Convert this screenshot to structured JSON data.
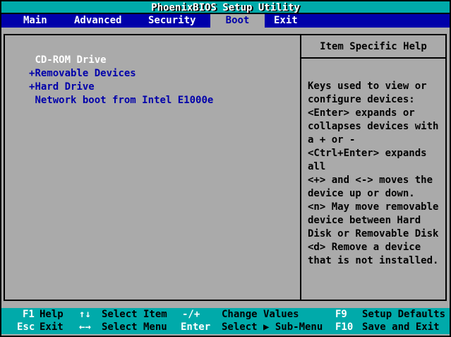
{
  "title": "PhoenixBIOS Setup Utility",
  "menu": {
    "tabs": [
      {
        "label": "Main",
        "active": false
      },
      {
        "label": "Advanced",
        "active": false
      },
      {
        "label": "Security",
        "active": false
      },
      {
        "label": "Boot",
        "active": true
      },
      {
        "label": "Exit",
        "active": false
      }
    ]
  },
  "boot_list": {
    "items": [
      {
        "prefix": " ",
        "label": "CD-ROM Drive",
        "selected": true
      },
      {
        "prefix": "+",
        "label": "Removable Devices",
        "selected": false
      },
      {
        "prefix": "+",
        "label": "Hard Drive",
        "selected": false
      },
      {
        "prefix": " ",
        "label": "Network boot from Intel E1000e",
        "selected": false
      }
    ]
  },
  "help_panel": {
    "title": "Item Specific Help",
    "body": "Keys used to view or\nconfigure devices:\n<Enter> expands or\ncollapses devices with\na + or -\n<Ctrl+Enter> expands\nall\n<+> and <-> moves the\ndevice up or down.\n<n> May move removable\ndevice between Hard\nDisk or Removable Disk\n<d> Remove a device\nthat is not installed."
  },
  "status_bar": {
    "row1": [
      {
        "key": "F1",
        "desc": "Help"
      },
      {
        "key": "↑↓",
        "desc": "Select Item"
      },
      {
        "key": "-/+",
        "desc": "Change Values"
      },
      {
        "key": "F9",
        "desc": "Setup Defaults"
      }
    ],
    "row2": [
      {
        "key": "Esc",
        "desc": "Exit"
      },
      {
        "key": "←→",
        "desc": "Select Menu"
      },
      {
        "key": "Enter",
        "desc": "Select ▶ Sub-Menu"
      },
      {
        "key": "F10",
        "desc": "Save and Exit"
      }
    ]
  },
  "colors": {
    "teal": "#00AAAA",
    "blue": "#0000AA",
    "gray": "#AAAAAA",
    "white": "#FFFFFF",
    "black": "#000000"
  }
}
